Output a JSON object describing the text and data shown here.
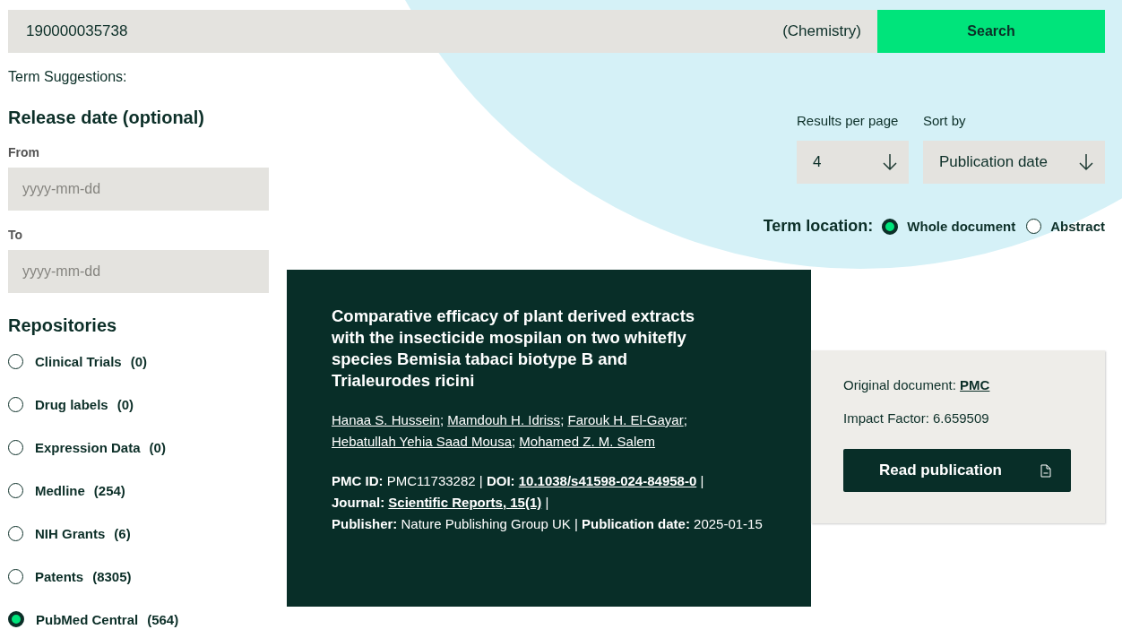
{
  "search": {
    "value": "190000035738",
    "scope": "(Chemistry)",
    "button": "Search"
  },
  "term_suggestions": "Term Suggestions:",
  "release_date": {
    "title": "Release date (optional)",
    "fields": [
      {
        "label": "From",
        "placeholder": "yyyy-mm-dd"
      },
      {
        "label": "To",
        "placeholder": "yyyy-mm-dd"
      }
    ]
  },
  "repositories": {
    "title": "Repositories",
    "items": [
      {
        "name": "Clinical Trials",
        "count": "(0)",
        "selected": false
      },
      {
        "name": "Drug labels",
        "count": "(0)",
        "selected": false
      },
      {
        "name": "Expression Data",
        "count": "(0)",
        "selected": false
      },
      {
        "name": "Medline",
        "count": "(254)",
        "selected": false
      },
      {
        "name": "NIH Grants",
        "count": "(6)",
        "selected": false
      },
      {
        "name": "Patents",
        "count": "(8305)",
        "selected": false
      },
      {
        "name": "PubMed Central",
        "count": "(564)",
        "selected": true
      }
    ]
  },
  "results_per_page": {
    "label": "Results per page",
    "value": "4"
  },
  "sort_by": {
    "label": "Sort by",
    "value": "Publication date"
  },
  "term_location": {
    "label": "Term location:",
    "options": [
      {
        "label": "Whole document",
        "selected": true
      },
      {
        "label": "Abstract",
        "selected": false
      }
    ]
  },
  "result": {
    "title": "Comparative efficacy of plant derived extracts with the insecticide mospilan on two whitefly species Bemisia tabaci biotype B and Trialeurodes ricini",
    "author_separator": ";",
    "authors": [
      "Hanaa S. Hussein",
      "Mamdouh H. Idriss",
      "Farouk H. El-Gayar",
      "Hebatullah Yehia Saad Mousa",
      "Mohamed Z. M. Salem"
    ],
    "meta_separator": "|",
    "meta": [
      {
        "label": "PMC ID:",
        "value": "PMC11733282",
        "link": false
      },
      {
        "label": "DOI:",
        "value": "10.1038/s41598-024-84958-0",
        "link": true
      },
      {
        "label": "Journal:",
        "value": "Scientific Reports, 15(1)",
        "link": true
      },
      {
        "label": "Publisher:",
        "value": "Nature Publishing Group UK",
        "link": false
      },
      {
        "label": "Publication date:",
        "value": "2025-01-15",
        "link": false
      }
    ]
  },
  "side_panel": {
    "original_label": "Original document:",
    "original_link": "PMC",
    "impact_factor": "Impact Factor: 6.659509",
    "button": "Read publication"
  }
}
